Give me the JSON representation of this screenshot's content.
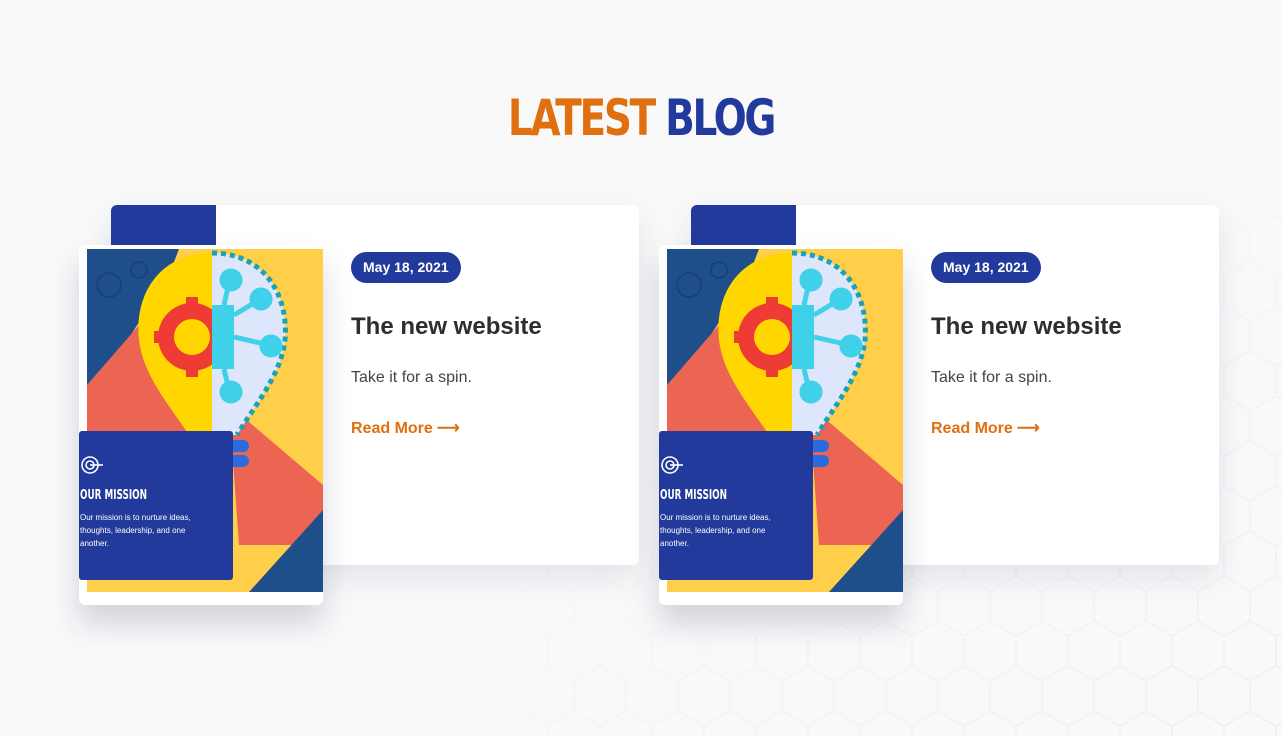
{
  "section": {
    "title_part1": "LATEST",
    "title_part2": "BLOG"
  },
  "colors": {
    "accent_orange": "#e0700f",
    "brand_blue": "#213a9b",
    "background": "#f9f9fa"
  },
  "posts": [
    {
      "date": "May 18, 2021",
      "title": "The new website",
      "excerpt": "Take it for a spin.",
      "read_more": "Read More",
      "image": {
        "heading": "OUR MISSION",
        "text_line1": "Our mission is to nurture ideas,",
        "text_line2": "thoughts, leadership, and one",
        "text_line3": "another."
      }
    },
    {
      "date": "May 18, 2021",
      "title": "The new website",
      "excerpt": "Take it for a spin.",
      "read_more": "Read More",
      "image": {
        "heading": "OUR MISSION",
        "text_line1": "Our mission is to nurture ideas,",
        "text_line2": "thoughts, leadership, and one",
        "text_line3": "another."
      }
    }
  ]
}
